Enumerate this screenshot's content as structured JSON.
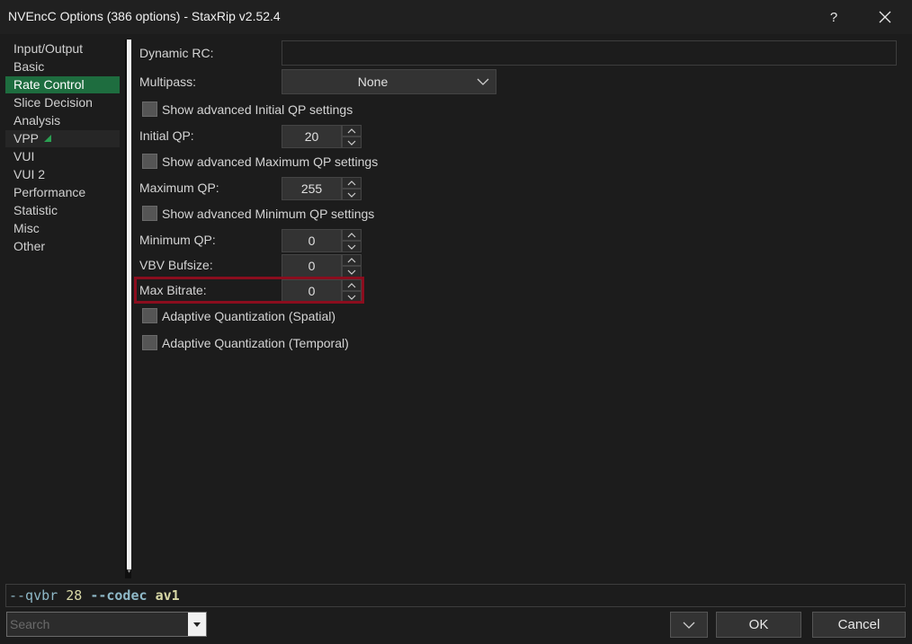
{
  "window": {
    "title": "NVEncC Options (386 options) - StaxRip v2.52.4",
    "help_label": "?"
  },
  "nav": {
    "items": [
      {
        "label": "Input/Output"
      },
      {
        "label": "Basic"
      },
      {
        "label": "Rate Control",
        "selected": true
      },
      {
        "label": "Slice Decision"
      },
      {
        "label": "Analysis"
      },
      {
        "label": "VPP",
        "expandable": true
      },
      {
        "label": "VUI"
      },
      {
        "label": "VUI 2"
      },
      {
        "label": "Performance"
      },
      {
        "label": "Statistic"
      },
      {
        "label": "Misc"
      },
      {
        "label": "Other"
      }
    ]
  },
  "form": {
    "dynamic_rc": {
      "label": "Dynamic RC:",
      "value": ""
    },
    "multipass": {
      "label": "Multipass:",
      "value": "None"
    },
    "show_adv_initial_qp": {
      "label": "Show advanced Initial QP settings",
      "checked": false
    },
    "initial_qp": {
      "label": "Initial QP:",
      "value": "20"
    },
    "show_adv_max_qp": {
      "label": "Show advanced Maximum QP settings",
      "checked": false
    },
    "maximum_qp": {
      "label": "Maximum QP:",
      "value": "255"
    },
    "show_adv_min_qp": {
      "label": "Show advanced Minimum QP settings",
      "checked": false
    },
    "minimum_qp": {
      "label": "Minimum QP:",
      "value": "0"
    },
    "vbv_bufsize": {
      "label": "VBV Bufsize:",
      "value": "0"
    },
    "max_bitrate": {
      "label": "Max Bitrate:",
      "value": "0"
    },
    "aq_spatial": {
      "label": "Adaptive Quantization (Spatial)",
      "checked": false
    },
    "aq_temporal": {
      "label": "Adaptive Quantization (Temporal)",
      "checked": false
    }
  },
  "cmdline": {
    "p1": "--qvbr",
    "v1": "28",
    "p2": "--codec",
    "v2": "av1"
  },
  "bottom": {
    "search_placeholder": "Search",
    "ok_label": "OK",
    "cancel_label": "Cancel"
  },
  "colors": {
    "accent": "#1e6d3f",
    "highlight_border": "#8b0d1e"
  }
}
